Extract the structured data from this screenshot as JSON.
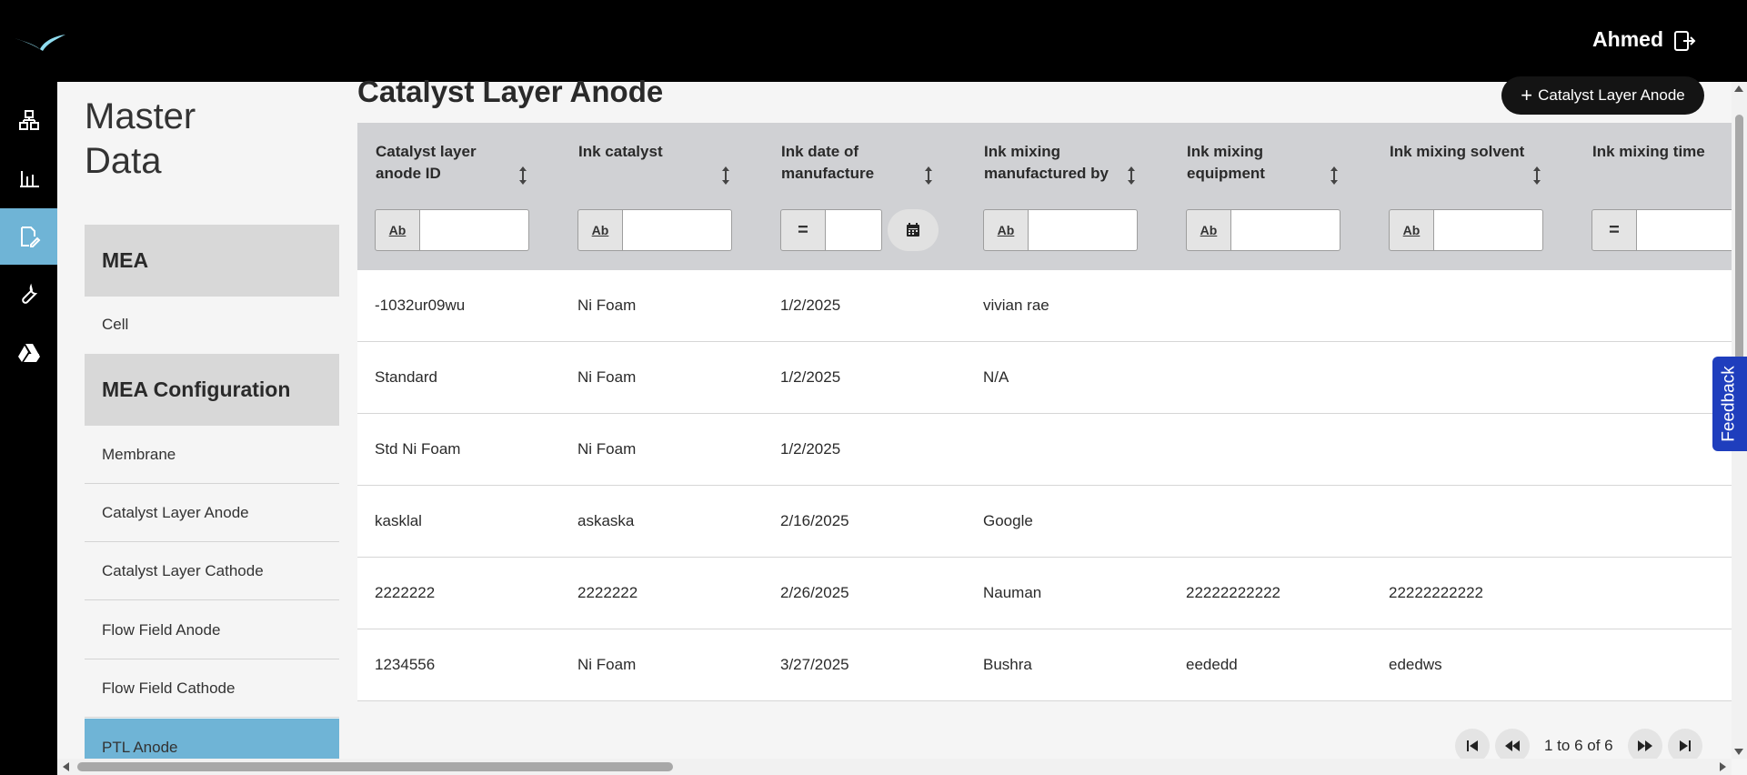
{
  "header": {
    "user_name": "Ahmed",
    "logo_icon": "bird-logo-icon",
    "logout_icon": "logout-icon"
  },
  "rail": {
    "items": [
      {
        "icon": "dashboard-icon",
        "active": false
      },
      {
        "icon": "bar-chart-icon",
        "active": false
      },
      {
        "icon": "document-edit-icon",
        "active": true
      },
      {
        "icon": "wrench-icon",
        "active": false
      },
      {
        "icon": "drive-icon",
        "active": false
      }
    ]
  },
  "sidebar": {
    "title_line1": "Master",
    "title_line2": "Data",
    "groups": [
      {
        "label": "MEA"
      },
      {
        "label": "MEA Configuration"
      }
    ],
    "items": [
      {
        "label": "Cell"
      },
      {
        "label": "Membrane"
      },
      {
        "label": "Catalyst Layer Anode"
      },
      {
        "label": "Catalyst Layer Cathode"
      },
      {
        "label": "Flow Field Anode"
      },
      {
        "label": "Flow Field Cathode"
      },
      {
        "label": "PTL Anode"
      }
    ]
  },
  "main": {
    "title": "Catalyst Layer Anode",
    "add_button_label": "Catalyst Layer Anode"
  },
  "grid": {
    "columns": [
      {
        "label": "Catalyst layer anode ID",
        "filter_type": "Ab"
      },
      {
        "label": "Ink catalyst",
        "filter_type": "Ab"
      },
      {
        "label": "Ink date of manufacture",
        "filter_type": "="
      },
      {
        "label": "Ink mixing manufactured by",
        "filter_type": "Ab"
      },
      {
        "label": "Ink mixing equipment",
        "filter_type": "Ab"
      },
      {
        "label": "Ink mixing solvent",
        "filter_type": "Ab"
      },
      {
        "label": "Ink mixing time",
        "filter_type": "="
      }
    ],
    "rows": [
      [
        "-1032ur09wu",
        "Ni Foam",
        "1/2/2025",
        "vivian rae",
        "",
        "",
        ""
      ],
      [
        "Standard",
        "Ni Foam",
        "1/2/2025",
        "N/A",
        "",
        "",
        ""
      ],
      [
        "Std Ni Foam",
        "Ni Foam",
        "1/2/2025",
        "",
        "",
        "",
        ""
      ],
      [
        "kasklal",
        "askaska",
        "2/16/2025",
        "Google",
        "",
        "",
        ""
      ],
      [
        "2222222",
        "2222222",
        "2/26/2025",
        "Nauman",
        "22222222222",
        "22222222222",
        ""
      ],
      [
        "1234556",
        "Ni Foam",
        "3/27/2025",
        "Bushra",
        "eededd",
        "ededws",
        ""
      ]
    ]
  },
  "pagination": {
    "text": "1 to 6 of 6"
  },
  "feedback_label": "Feedback",
  "colors": {
    "topbar": "#000000",
    "active_nav": "#6fb4d6",
    "header_grid": "#d0d1d4",
    "feedback": "#1f3ebd"
  }
}
